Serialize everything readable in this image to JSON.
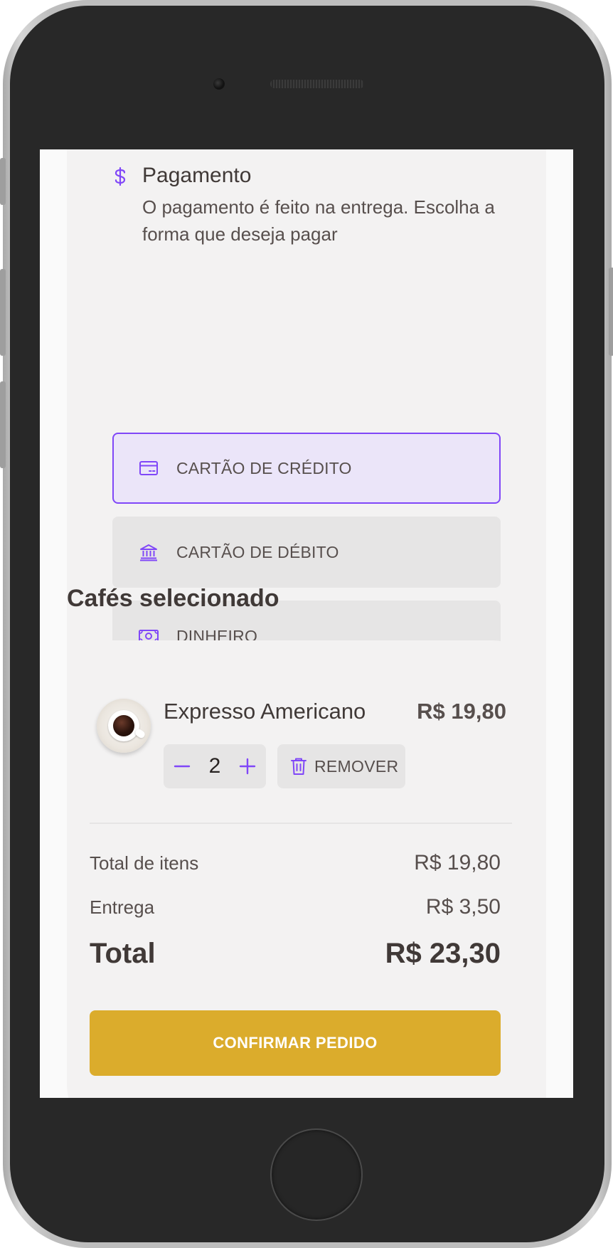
{
  "payment": {
    "title": "Pagamento",
    "subtitle": "O pagamento é feito na entrega. Escolha a forma que deseja pagar",
    "options": [
      {
        "label": "CARTÃO DE CRÉDITO",
        "icon": "credit-card-icon",
        "selected": true
      },
      {
        "label": "CARTÃO DE DÉBITO",
        "icon": "bank-icon",
        "selected": false
      },
      {
        "label": "DINHEIRO",
        "icon": "money-icon",
        "selected": false
      }
    ]
  },
  "cart": {
    "section_title": "Cafés selecionado",
    "items": [
      {
        "name": "Expresso Americano",
        "price": "R$ 19,80",
        "quantity": "2",
        "remove_label": "REMOVER"
      }
    ],
    "summary": {
      "items_label": "Total de itens",
      "items_value": "R$ 19,80",
      "delivery_label": "Entrega",
      "delivery_value": "R$ 3,50",
      "total_label": "Total",
      "total_value": "R$ 23,30"
    },
    "confirm_label": "CONFIRMAR PEDIDO"
  },
  "colors": {
    "accent": "#8047f8",
    "accent_light": "#ebe5f9",
    "confirm": "#dbac2c",
    "card_bg": "#f3f2f2"
  }
}
